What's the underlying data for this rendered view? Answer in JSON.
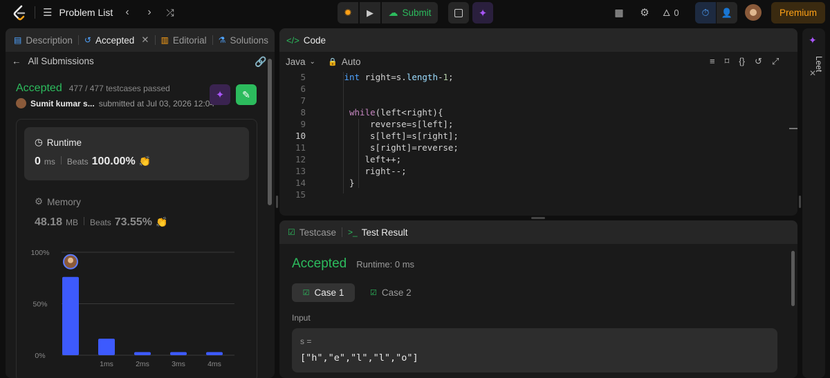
{
  "topbar": {
    "problem_list": "Problem List",
    "submit": "Submit",
    "streak_count": "0",
    "premium": "Premium"
  },
  "left_panel": {
    "tabs": [
      {
        "label": "Description"
      },
      {
        "label": "Accepted"
      },
      {
        "label": "Editorial"
      },
      {
        "label": "Solutions"
      }
    ],
    "all_submissions": "All Submissions",
    "status": "Accepted",
    "testcases": "477 / 477 testcases passed",
    "user": "Sumit kumar s...",
    "submitted_at": "submitted at Jul 03, 2026 12:04",
    "runtime": {
      "title": "Runtime",
      "value": "0",
      "unit": "ms",
      "beats_label": "Beats",
      "beats": "100.00%"
    },
    "memory": {
      "title": "Memory",
      "value": "48.18",
      "unit": "MB",
      "beats_label": "Beats",
      "beats": "73.55%"
    }
  },
  "chart_data": {
    "type": "bar",
    "categories": [
      "",
      "1ms",
      "2ms",
      "3ms",
      "4ms"
    ],
    "values": [
      76,
      16,
      3,
      3,
      3
    ],
    "ylim": [
      0,
      100
    ],
    "yticks": [
      "100%",
      "50%",
      "0%"
    ],
    "grid": true,
    "bar_color": "#3d5afe"
  },
  "code_panel": {
    "title": "Code",
    "language": "Java",
    "mode": "Auto",
    "line_numbers": [
      "5",
      "6",
      "7",
      "8",
      "9",
      "10",
      "11",
      "12",
      "13",
      "14",
      "15"
    ],
    "lines": [
      "int right=s.length-1;",
      "",
      "",
      "while(left<right){",
      "reverse=s[left];",
      "s[left]=s[right];",
      "s[right]=reverse;",
      "left++;",
      "right--;",
      "}",
      ""
    ]
  },
  "test_panel": {
    "tabs": [
      {
        "label": "Testcase"
      },
      {
        "label": "Test Result"
      }
    ],
    "status": "Accepted",
    "runtime": "Runtime: 0 ms",
    "cases": [
      {
        "label": "Case 1"
      },
      {
        "label": "Case 2"
      }
    ],
    "input_label": "Input",
    "var_name": "s =",
    "var_value": "[\"h\",\"e\",\"l\",\"l\",\"o\"]"
  },
  "right_strip": {
    "label": "Leet"
  },
  "colors": {
    "accent_green": "#2cbb5d",
    "premium": "#ffa116",
    "purple": "#a855f7",
    "bar": "#3d5afe"
  }
}
